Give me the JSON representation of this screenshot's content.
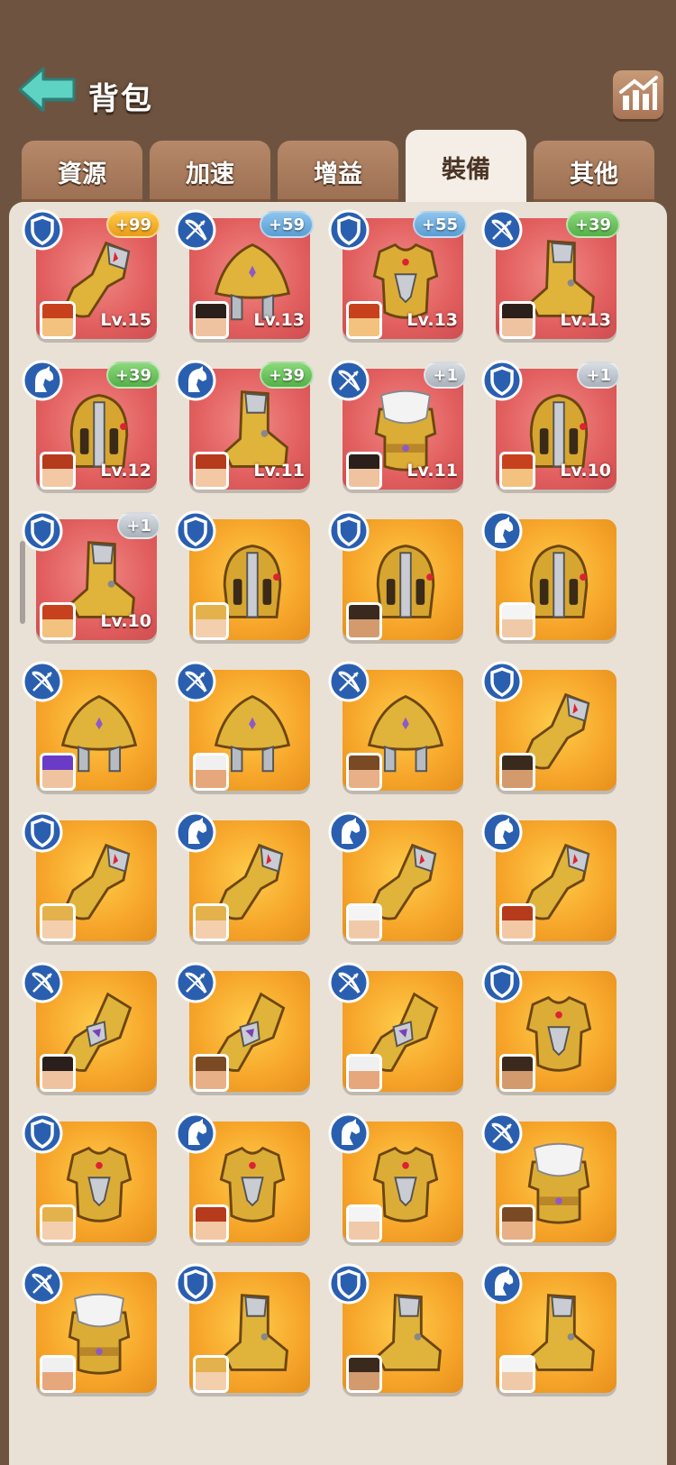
{
  "header": {
    "title": "背包",
    "back_icon": "back-arrow-icon",
    "stats_icon": "bar-chart-icon"
  },
  "tabs": [
    {
      "label": "資源",
      "active": false
    },
    {
      "label": "加速",
      "active": false
    },
    {
      "label": "增益",
      "active": false
    },
    {
      "label": "裝備",
      "active": true
    },
    {
      "label": "其他",
      "active": false
    }
  ],
  "colors": {
    "accent_back": "#4fc7b9",
    "tab_active_bg": "#f4eee6",
    "rare_bg": "#e25f5f",
    "epic_bg": "#f6a52a"
  },
  "items": [
    {
      "class": "shield",
      "piece": "gauntlet",
      "rarity": "red",
      "bonus": "+99",
      "badge": "gold",
      "level": "Lv.15",
      "hero": "spartan"
    },
    {
      "class": "bow",
      "piece": "hat",
      "rarity": "red",
      "bonus": "+59",
      "badge": "blue",
      "level": "Lv.13",
      "hero": "girl"
    },
    {
      "class": "shield",
      "piece": "chest",
      "rarity": "red",
      "bonus": "+55",
      "badge": "blue",
      "level": "Lv.13",
      "hero": "spartan"
    },
    {
      "class": "bow",
      "piece": "boot",
      "rarity": "red",
      "bonus": "+39",
      "badge": "green",
      "level": "Lv.13",
      "hero": "girl"
    },
    {
      "class": "horse",
      "piece": "helm",
      "rarity": "red",
      "bonus": "+39",
      "badge": "green",
      "level": "Lv.12",
      "hero": "redhair"
    },
    {
      "class": "horse",
      "piece": "boot",
      "rarity": "red",
      "bonus": "+39",
      "badge": "green",
      "level": "Lv.11",
      "hero": "redhair"
    },
    {
      "class": "bow",
      "piece": "chest-scarf",
      "rarity": "red",
      "bonus": "+1",
      "badge": "silver",
      "level": "Lv.11",
      "hero": "girl"
    },
    {
      "class": "shield",
      "piece": "helm",
      "rarity": "red",
      "bonus": "+1",
      "badge": "silver",
      "level": "Lv.10",
      "hero": "spartan"
    },
    {
      "class": "shield",
      "piece": "boot",
      "rarity": "red",
      "bonus": "+1",
      "badge": "silver",
      "level": "Lv.10",
      "hero": "spartan"
    },
    {
      "class": "shield",
      "piece": "helm",
      "rarity": "orange",
      "bonus": "",
      "badge": "",
      "level": "",
      "hero": "blonde"
    },
    {
      "class": "shield",
      "piece": "helm",
      "rarity": "orange",
      "bonus": "",
      "badge": "",
      "level": "",
      "hero": "dark"
    },
    {
      "class": "horse",
      "piece": "helm",
      "rarity": "orange",
      "bonus": "",
      "badge": "",
      "level": "",
      "hero": "veiled"
    },
    {
      "class": "bow",
      "piece": "hat",
      "rarity": "orange",
      "bonus": "",
      "badge": "",
      "level": "",
      "hero": "purple"
    },
    {
      "class": "bow",
      "piece": "hat",
      "rarity": "orange",
      "bonus": "",
      "badge": "",
      "level": "",
      "hero": "elder"
    },
    {
      "class": "bow",
      "piece": "hat",
      "rarity": "orange",
      "bonus": "",
      "badge": "",
      "level": "",
      "hero": "ranger"
    },
    {
      "class": "shield",
      "piece": "gauntlet",
      "rarity": "orange",
      "bonus": "",
      "badge": "",
      "level": "",
      "hero": "dark"
    },
    {
      "class": "shield",
      "piece": "gauntlet",
      "rarity": "orange",
      "bonus": "",
      "badge": "",
      "level": "",
      "hero": "blonde"
    },
    {
      "class": "horse",
      "piece": "gauntlet",
      "rarity": "orange",
      "bonus": "",
      "badge": "",
      "level": "",
      "hero": "blonde"
    },
    {
      "class": "horse",
      "piece": "gauntlet",
      "rarity": "orange",
      "bonus": "",
      "badge": "",
      "level": "",
      "hero": "veiled"
    },
    {
      "class": "horse",
      "piece": "gauntlet",
      "rarity": "orange",
      "bonus": "",
      "badge": "",
      "level": "",
      "hero": "redhair"
    },
    {
      "class": "bow",
      "piece": "gauntlet-gem",
      "rarity": "orange",
      "bonus": "",
      "badge": "",
      "level": "",
      "hero": "girl"
    },
    {
      "class": "bow",
      "piece": "gauntlet-gem",
      "rarity": "orange",
      "bonus": "",
      "badge": "",
      "level": "",
      "hero": "ranger"
    },
    {
      "class": "bow",
      "piece": "gauntlet-gem",
      "rarity": "orange",
      "bonus": "",
      "badge": "",
      "level": "",
      "hero": "elder"
    },
    {
      "class": "shield",
      "piece": "chest",
      "rarity": "orange",
      "bonus": "",
      "badge": "",
      "level": "",
      "hero": "dark"
    },
    {
      "class": "shield",
      "piece": "chest",
      "rarity": "orange",
      "bonus": "",
      "badge": "",
      "level": "",
      "hero": "blonde"
    },
    {
      "class": "horse",
      "piece": "chest",
      "rarity": "orange",
      "bonus": "",
      "badge": "",
      "level": "",
      "hero": "redhair"
    },
    {
      "class": "horse",
      "piece": "chest",
      "rarity": "orange",
      "bonus": "",
      "badge": "",
      "level": "",
      "hero": "veiled"
    },
    {
      "class": "bow",
      "piece": "chest-scarf",
      "rarity": "orange",
      "bonus": "",
      "badge": "",
      "level": "",
      "hero": "ranger"
    },
    {
      "class": "bow",
      "piece": "chest-scarf",
      "rarity": "orange",
      "bonus": "",
      "badge": "",
      "level": "",
      "hero": "elder"
    },
    {
      "class": "shield",
      "piece": "boot",
      "rarity": "orange",
      "bonus": "",
      "badge": "",
      "level": "",
      "hero": "blonde"
    },
    {
      "class": "shield",
      "piece": "boot",
      "rarity": "orange",
      "bonus": "",
      "badge": "",
      "level": "",
      "hero": "dark"
    },
    {
      "class": "horse",
      "piece": "boot",
      "rarity": "orange",
      "bonus": "",
      "badge": "",
      "level": "",
      "hero": "veiled"
    }
  ]
}
